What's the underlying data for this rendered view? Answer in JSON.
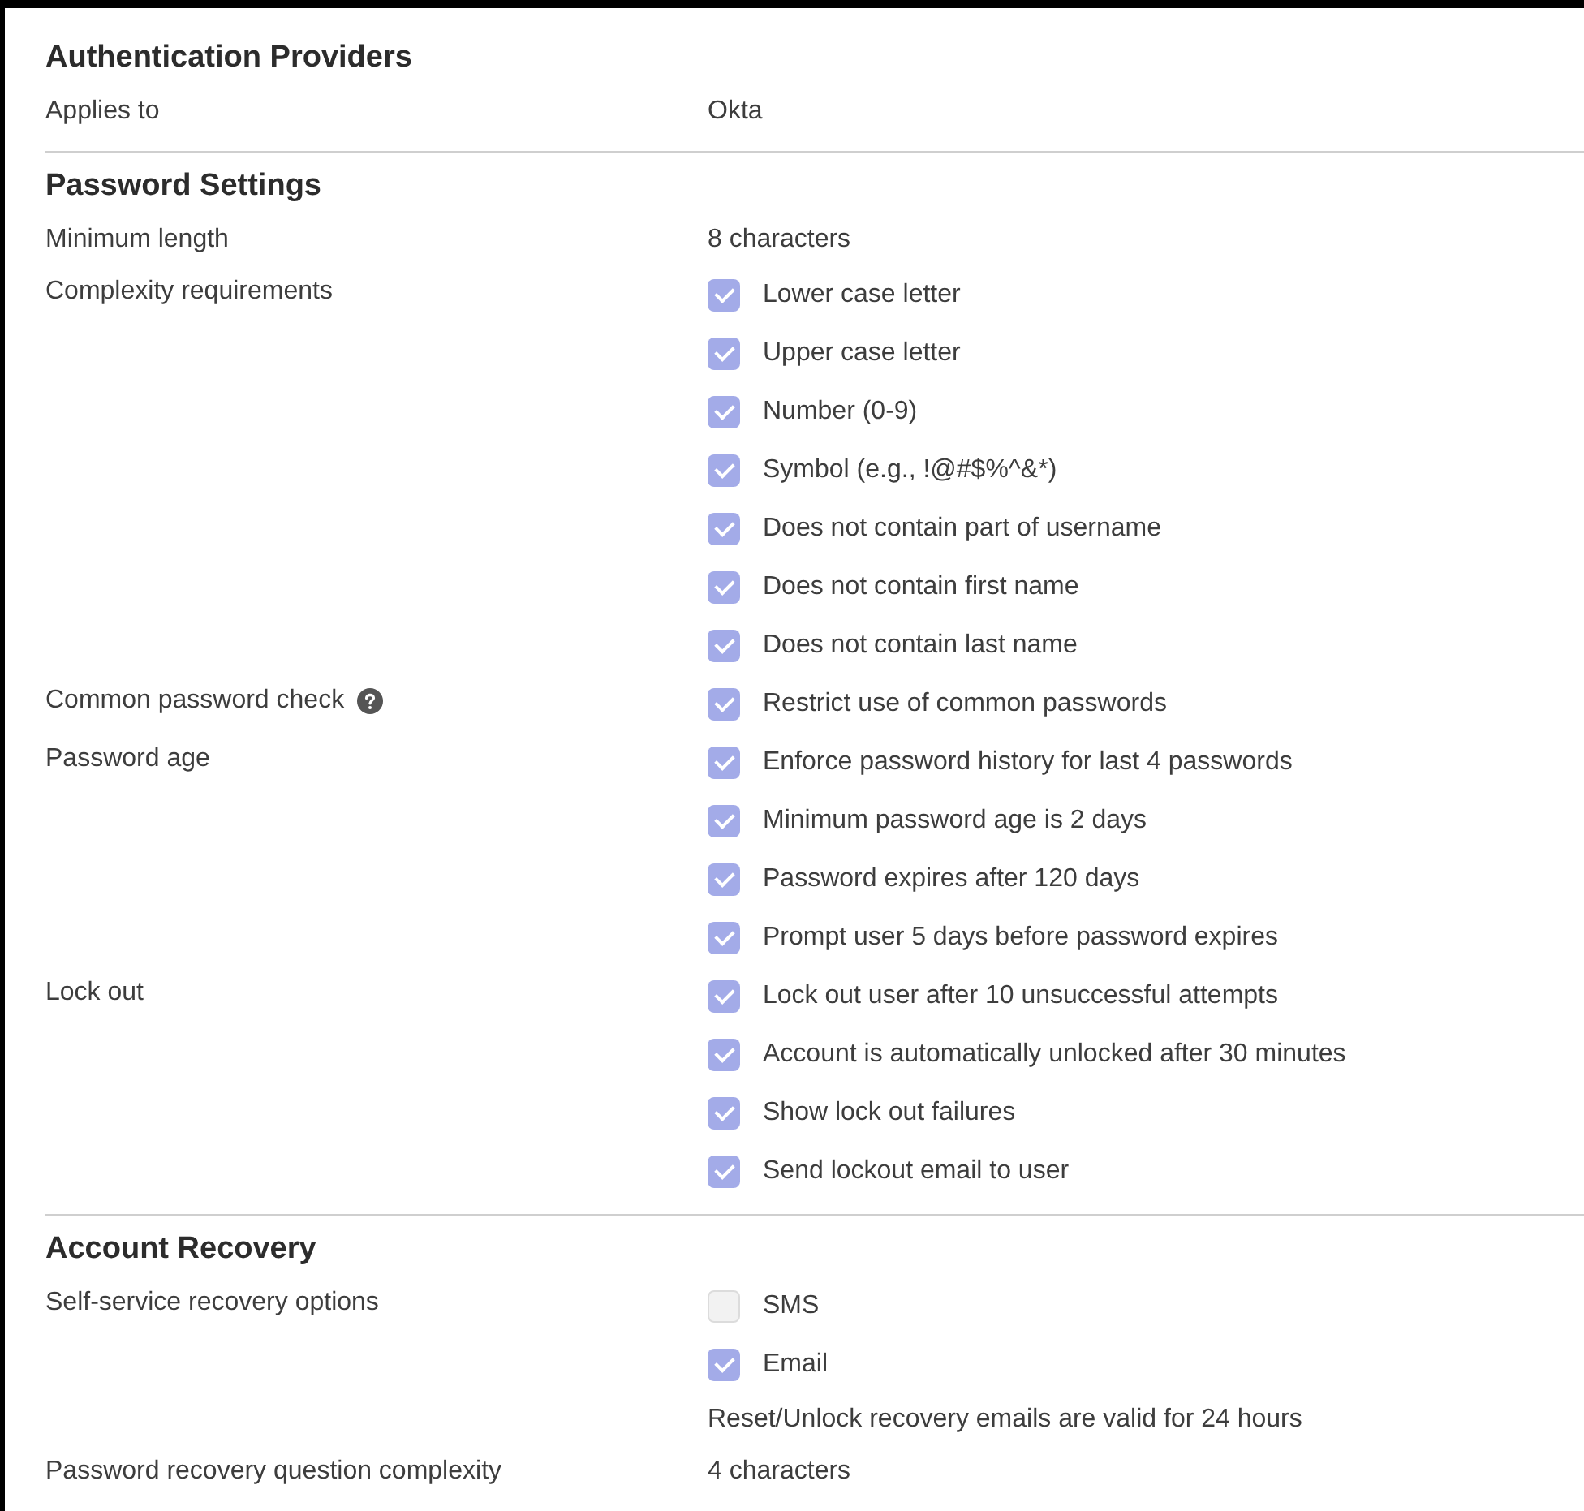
{
  "sections": [
    {
      "title": "Authentication Providers",
      "rows": [
        {
          "label": "Applies to",
          "items": [
            {
              "kind": "text",
              "text": "Okta"
            }
          ]
        }
      ]
    },
    {
      "title": "Password Settings",
      "rows": [
        {
          "label": "Minimum length",
          "items": [
            {
              "kind": "text",
              "text": "8 characters"
            }
          ]
        },
        {
          "label": "Complexity requirements",
          "items": [
            {
              "kind": "checkbox",
              "text": "Lower case letter",
              "checked": true
            },
            {
              "kind": "checkbox",
              "text": "Upper case letter",
              "checked": true
            },
            {
              "kind": "checkbox",
              "text": "Number (0-9)",
              "checked": true
            },
            {
              "kind": "checkbox",
              "text": "Symbol (e.g., !@#$%^&*)",
              "checked": true
            },
            {
              "kind": "checkbox",
              "text": "Does not contain part of username",
              "checked": true
            },
            {
              "kind": "checkbox",
              "text": "Does not contain first name",
              "checked": true
            },
            {
              "kind": "checkbox",
              "text": "Does not contain last name",
              "checked": true
            }
          ]
        },
        {
          "label": "Common password check",
          "help": true,
          "items": [
            {
              "kind": "checkbox",
              "text": "Restrict use of common passwords",
              "checked": true
            }
          ]
        },
        {
          "label": "Password age",
          "items": [
            {
              "kind": "checkbox",
              "text": "Enforce password history for last 4 passwords",
              "checked": true
            },
            {
              "kind": "checkbox",
              "text": "Minimum password age is 2 days",
              "checked": true
            },
            {
              "kind": "checkbox",
              "text": "Password expires after 120 days",
              "checked": true
            },
            {
              "kind": "checkbox",
              "text": "Prompt user 5 days before password expires",
              "checked": true
            }
          ]
        },
        {
          "label": "Lock out",
          "items": [
            {
              "kind": "checkbox",
              "text": "Lock out user after 10 unsuccessful attempts",
              "checked": true
            },
            {
              "kind": "checkbox",
              "text": "Account is automatically unlocked after 30 minutes",
              "checked": true
            },
            {
              "kind": "checkbox",
              "text": "Show lock out failures",
              "checked": true
            },
            {
              "kind": "checkbox",
              "text": "Send lockout email to user",
              "checked": true
            }
          ]
        }
      ]
    },
    {
      "title": "Account Recovery",
      "rows": [
        {
          "label": "Self-service recovery options",
          "items": [
            {
              "kind": "checkbox",
              "text": "SMS",
              "checked": false
            },
            {
              "kind": "checkbox",
              "text": "Email",
              "checked": true
            },
            {
              "kind": "text",
              "text": "Reset/Unlock recovery emails are valid for 24 hours"
            }
          ]
        },
        {
          "label": "Password recovery question complexity",
          "items": [
            {
              "kind": "text",
              "text": "4 characters"
            }
          ]
        }
      ]
    }
  ]
}
